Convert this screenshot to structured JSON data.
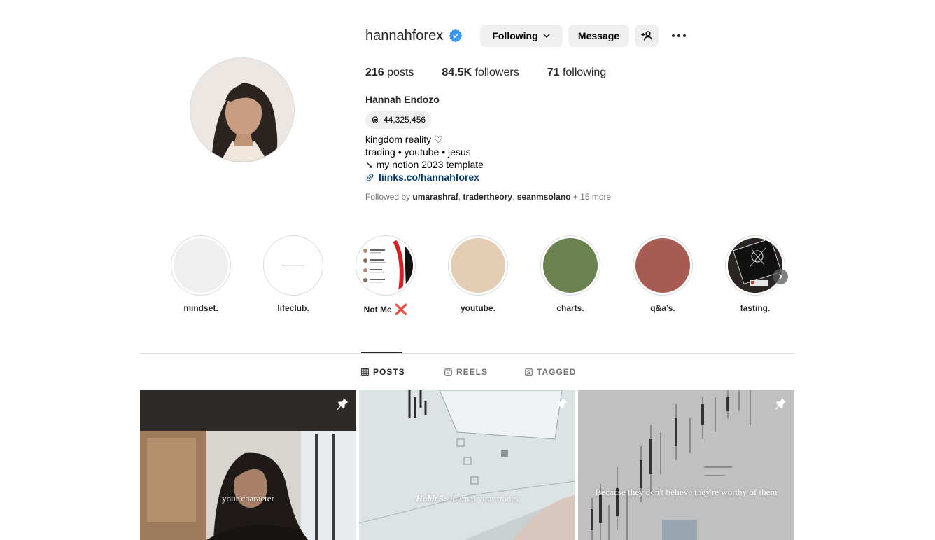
{
  "profile": {
    "username": "hannahforex",
    "full_name": "Hannah Endozo",
    "threads_count": "44,325,456",
    "buttons": {
      "following": "Following",
      "message": "Message"
    },
    "stats": [
      {
        "value": "216",
        "label": "posts"
      },
      {
        "value": "84.5K",
        "label": "followers"
      },
      {
        "value": "71",
        "label": "following"
      }
    ],
    "bio": [
      "kingdom reality ♡",
      "trading • youtube • jesus",
      "↘ my notion 2023 template"
    ],
    "link": "liinks.co/hannahforex",
    "followed_by": {
      "prefix": "Followed by",
      "users": [
        "umarashraf",
        "tradertheory",
        "seanmsolano"
      ],
      "more": "+ 15 more"
    }
  },
  "highlights": [
    {
      "label": "mindset.",
      "color": "#efefef"
    },
    {
      "label": "lifeclub.",
      "color": "#ffffff"
    },
    {
      "label": "Not Me",
      "color": "#ffffff",
      "badge": "❌"
    },
    {
      "label": "youtube.",
      "color": "#e3cdb4"
    },
    {
      "label": "charts.",
      "color": "#6a8150"
    },
    {
      "label": "q&a’s.",
      "color": "#a65c52"
    },
    {
      "label": "fasting.",
      "color": "#2a2422"
    }
  ],
  "tabs": [
    {
      "label": "POSTS",
      "active": true
    },
    {
      "label": "REELS",
      "active": false
    },
    {
      "label": "TAGGED",
      "active": false
    }
  ],
  "posts": [
    {
      "caption": "your character",
      "pinned": true
    },
    {
      "caption_em": "Habit 5:",
      "caption": "Journal your trades",
      "pinned": true
    },
    {
      "caption": "Because they don't believe they're worthy of them",
      "pinned": true
    }
  ],
  "colors": {
    "verified": "#3897f0",
    "link": "#00376b",
    "secondary_text": "#737373",
    "button_bg": "#efefef"
  }
}
